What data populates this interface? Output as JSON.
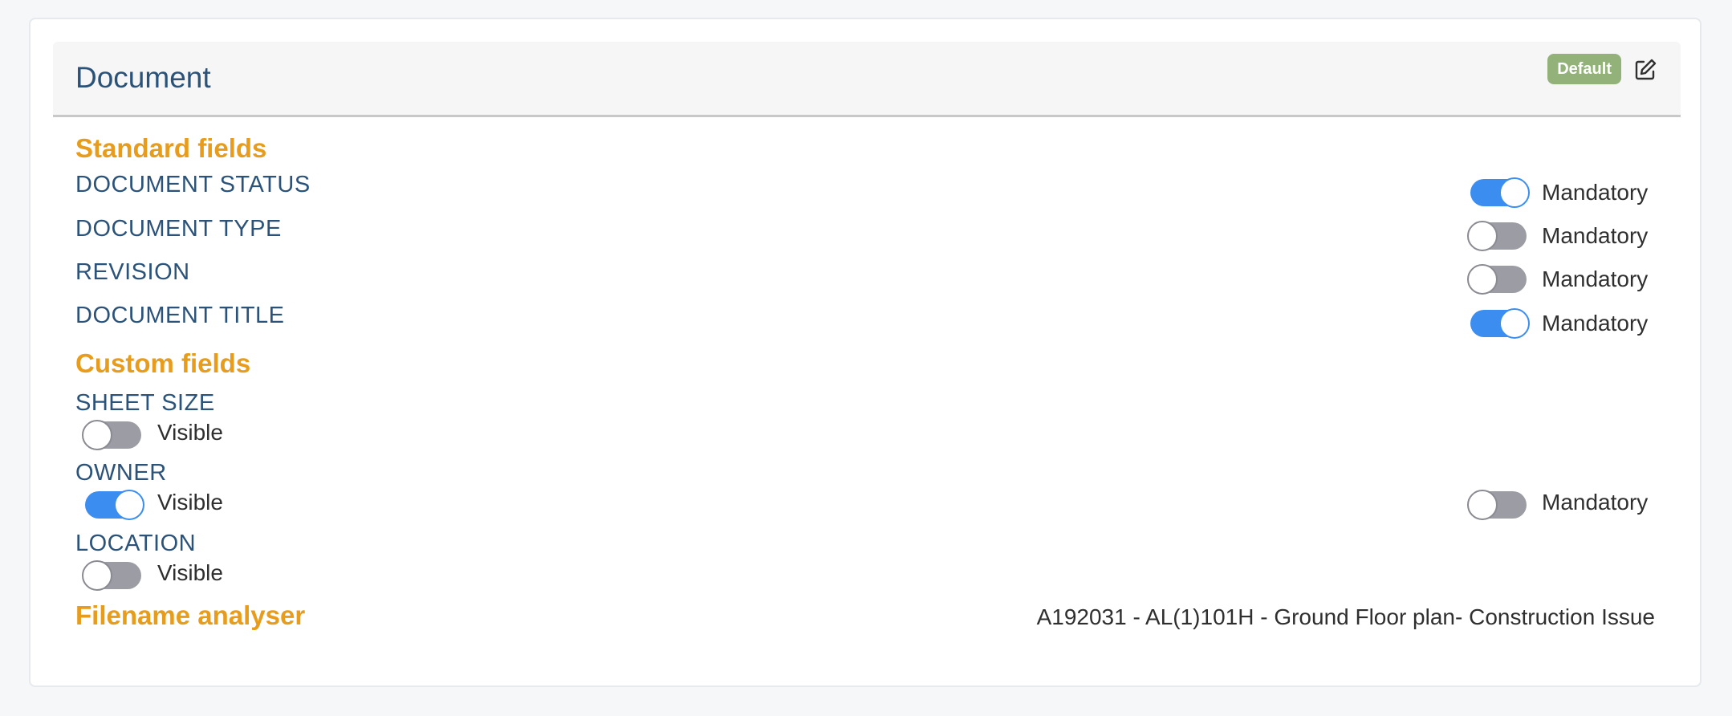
{
  "header": {
    "title": "Document",
    "badge": "Default",
    "edit_icon": "edit-icon"
  },
  "standard_fields": {
    "heading": "Standard fields",
    "items": [
      {
        "label": "DOCUMENT STATUS",
        "toggle_label": "Mandatory",
        "mandatory": true
      },
      {
        "label": "DOCUMENT TYPE",
        "toggle_label": "Mandatory",
        "mandatory": false
      },
      {
        "label": "REVISION",
        "toggle_label": "Mandatory",
        "mandatory": false
      },
      {
        "label": "DOCUMENT TITLE",
        "toggle_label": "Mandatory",
        "mandatory": true
      }
    ]
  },
  "custom_fields": {
    "heading": "Custom fields",
    "items": [
      {
        "label": "SHEET SIZE",
        "visible_label": "Visible",
        "visible": false
      },
      {
        "label": "OWNER",
        "visible_label": "Visible",
        "visible": true,
        "mandatory_label": "Mandatory",
        "mandatory": false
      },
      {
        "label": "LOCATION",
        "visible_label": "Visible",
        "visible": false
      }
    ]
  },
  "filename_analyser": {
    "heading": "Filename analyser",
    "value": "A192031 - AL(1)101H - Ground Floor plan- Construction Issue"
  },
  "colors": {
    "accent_blue": "#3b8ef0",
    "title_blue": "#2b5279",
    "heading_orange": "#e89c1c",
    "badge_green": "#93b27a"
  }
}
